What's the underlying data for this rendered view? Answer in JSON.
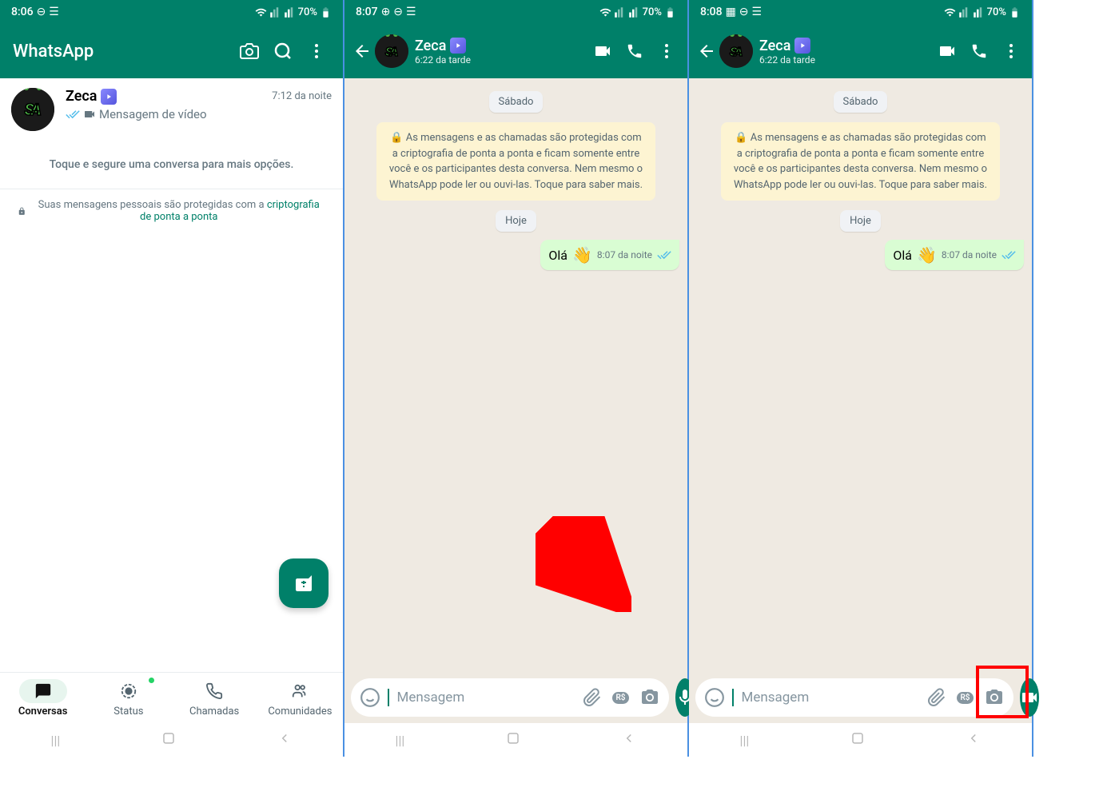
{
  "screen1": {
    "status": {
      "time": "8:06",
      "battery": "70%"
    },
    "header": {
      "title": "WhatsApp"
    },
    "chat_item": {
      "name": "Zeca",
      "time": "7:12 da noite",
      "preview": "Mensagem de vídeo"
    },
    "hint": "Toque e segure uma conversa para mais opções.",
    "encryption": {
      "text_before": "Suas mensagens pessoais são protegidas com a ",
      "link": "criptografia de ponta a ponta"
    },
    "nav": {
      "conversas": "Conversas",
      "status": "Status",
      "chamadas": "Chamadas",
      "comunidades": "Comunidades"
    }
  },
  "screen2": {
    "status": {
      "time": "8:07",
      "battery": "70%"
    },
    "header": {
      "name": "Zeca",
      "sub": "6:22 da tarde"
    },
    "date1": "Sábado",
    "banner": "🔒 As mensagens e as chamadas são protegidas com a criptografia de ponta a ponta e ficam somente entre você e os participantes desta conversa. Nem mesmo o WhatsApp pode ler ou ouvi-las. Toque para saber mais.",
    "date2": "Hoje",
    "msg": {
      "text": "Olá",
      "emoji": "👋",
      "time": "8:07 da noite"
    },
    "input_placeholder": "Mensagem"
  },
  "screen3": {
    "status": {
      "time": "8:08",
      "battery": "70%"
    },
    "header": {
      "name": "Zeca",
      "sub": "6:22 da tarde"
    },
    "date1": "Sábado",
    "banner": "🔒 As mensagens e as chamadas são protegidas com a criptografia de ponta a ponta e ficam somente entre você e os participantes desta conversa. Nem mesmo o WhatsApp pode ler ou ouvi-las. Toque para saber mais.",
    "date2": "Hoje",
    "msg": {
      "text": "Olá",
      "emoji": "👋",
      "time": "8:07 da noite"
    },
    "input_placeholder": "Mensagem"
  }
}
